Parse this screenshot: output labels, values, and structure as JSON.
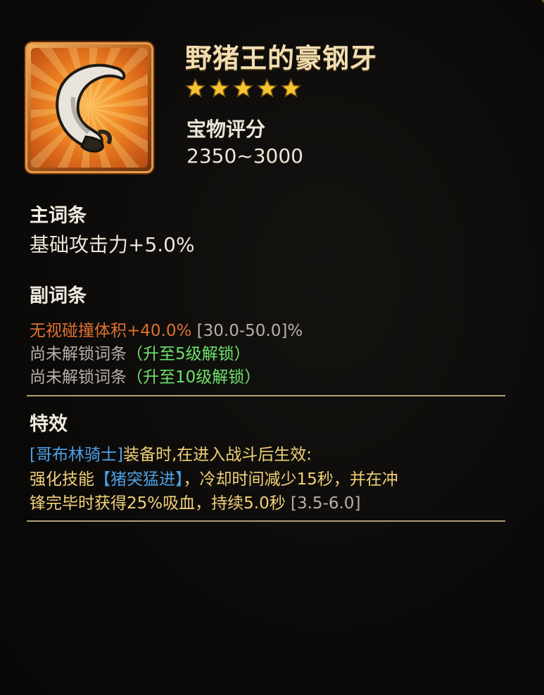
{
  "item": {
    "icon": "boar-fang-icon",
    "name": "野猪王的豪钢牙",
    "stars": 5,
    "score_label": "宝物评分",
    "score_value": "2350~3000"
  },
  "main_attr": {
    "title": "主词条",
    "stat": "基础攻击力+5.0%"
  },
  "sub_attr": {
    "title": "副词条",
    "lines": [
      {
        "text": "无视碰撞体积+40.0%",
        "range": " [30.0-50.0]%"
      },
      {
        "text": "尚未解锁词条",
        "note": "（升至5级解锁）"
      },
      {
        "text": "尚未解锁词条",
        "note": "（升至10级解锁）"
      }
    ]
  },
  "effect": {
    "title": "特效",
    "hero": "[哥布林骑士]",
    "line1_rest": "装备时,在进入战斗后生效:",
    "line2_prefix": "强化技能",
    "skill": "【猪突猛进】",
    "line2_rest": "，冷却时间减少15秒，并在冲",
    "line3": "锋完毕时获得25%吸血，持续5.0秒",
    "line3_range": " [3.5-6.0]"
  },
  "colors": {
    "highlight_orange": "#e0702e",
    "unlock_green": "#6ee36b",
    "hero_blue": "#4da0e6",
    "effect_yellow": "#f0d078",
    "star_gold": "#f5c531"
  }
}
